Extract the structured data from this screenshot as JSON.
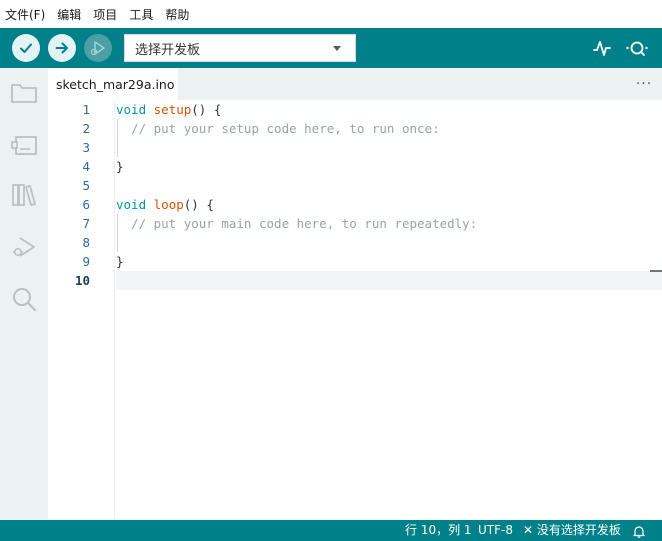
{
  "menu": [
    "文件(F)",
    "编辑",
    "项目",
    "工具",
    "帮助"
  ],
  "toolbar": {
    "verify_icon": "checkmark-icon",
    "upload_icon": "arrow-right-icon",
    "debug_icon": "debug-play-icon",
    "board_select": "选择开发板",
    "serial_plotter_icon": "serial-plotter-icon",
    "serial_monitor_icon": "serial-monitor-icon"
  },
  "sidebar": [
    "folder-icon",
    "board-manager-icon",
    "library-icon",
    "debug-icon",
    "search-icon"
  ],
  "tab": {
    "filename": "sketch_mar29a.ino",
    "menu": "···"
  },
  "editor": {
    "line_numbers": [
      "1",
      "2",
      "3",
      "4",
      "5",
      "6",
      "7",
      "8",
      "9",
      "10"
    ],
    "active_line": "10",
    "lines": [
      {
        "kw": "void",
        "fn": "setup",
        "rest": "() {"
      },
      {
        "comment": "  // put your setup code here, to run once:"
      },
      {
        "text": ""
      },
      {
        "text": "}"
      },
      {
        "text": ""
      },
      {
        "kw": "void",
        "fn": "loop",
        "rest": "() {"
      },
      {
        "comment": "  // put your main code here, to run repeatedly:"
      },
      {
        "text": ""
      },
      {
        "text": "}"
      },
      {
        "text": ""
      }
    ]
  },
  "status": {
    "position": "行 10，列 1",
    "encoding": "UTF-8",
    "board": "没有选择开发板",
    "close_symbol": "✕",
    "bell_icon": "bell-icon"
  },
  "colors": {
    "teal": "#00818a",
    "keyword": "#00979c",
    "function": "#d35400",
    "comment": "#95a5a6"
  }
}
